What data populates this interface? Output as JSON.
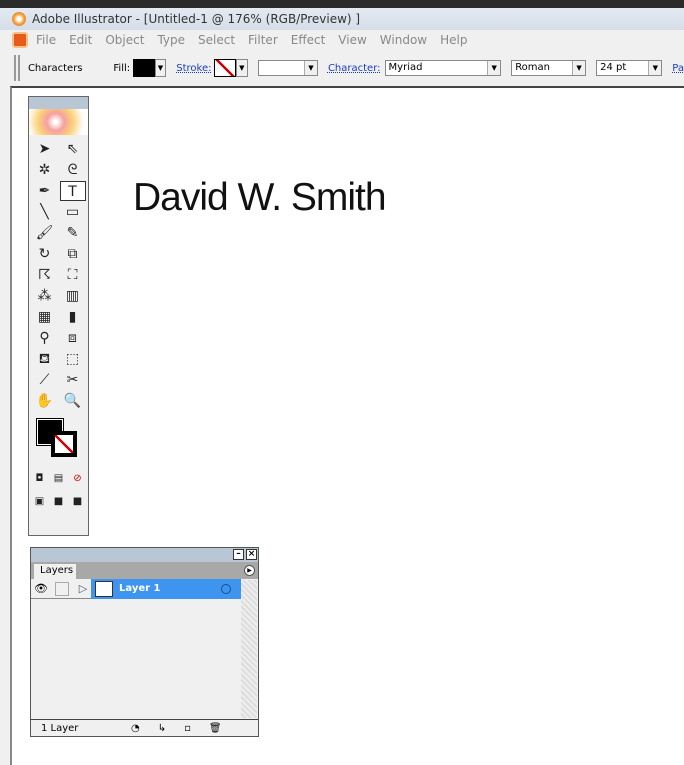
{
  "window": {
    "title": "Adobe Illustrator - [Untitled-1 @ 176% (RGB/Preview) ]"
  },
  "menu": [
    "File",
    "Edit",
    "Object",
    "Type",
    "Select",
    "Filter",
    "Effect",
    "View",
    "Window",
    "Help"
  ],
  "control": {
    "mode": "Characters",
    "fill_label": "Fill:",
    "stroke_label": "Stroke:",
    "character_label": "Character:",
    "font": "Myriad",
    "style": "Roman",
    "size": "24 pt",
    "paragraph_label": "Pa",
    "fill_color": "#000000"
  },
  "document": {
    "text": "David W. Smith"
  },
  "toolbox": {
    "tools": [
      "selection",
      "direct-selection",
      "magic-wand",
      "lasso",
      "pen",
      "type",
      "line",
      "rectangle",
      "paintbrush",
      "pencil",
      "rotate",
      "scale",
      "warp",
      "free-transform",
      "symbol-sprayer",
      "column-graph",
      "mesh",
      "gradient",
      "eyedropper",
      "blend",
      "live-paint",
      "live-paint-selection",
      "slice",
      "scissors",
      "hand",
      "zoom"
    ]
  },
  "layers": {
    "tab": "Layers",
    "rows": [
      {
        "name": "Layer 1",
        "color": "#3d95f0"
      }
    ],
    "count": "1 Layer"
  }
}
